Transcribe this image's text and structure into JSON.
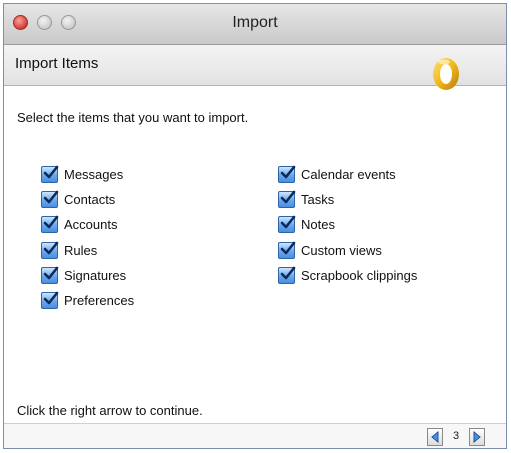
{
  "window": {
    "title": "Import"
  },
  "header": {
    "title": "Import Items",
    "logo_icon": "outlook-o-logo-icon"
  },
  "instruction": "Select the items that you want to import.",
  "items_left": [
    {
      "label": "Messages",
      "checked": true
    },
    {
      "label": "Contacts",
      "checked": true
    },
    {
      "label": "Accounts",
      "checked": true
    },
    {
      "label": "Rules",
      "checked": true
    },
    {
      "label": "Signatures",
      "checked": true
    },
    {
      "label": "Preferences",
      "checked": true
    }
  ],
  "items_right": [
    {
      "label": "Calendar events",
      "checked": true
    },
    {
      "label": "Tasks",
      "checked": true
    },
    {
      "label": "Notes",
      "checked": true
    },
    {
      "label": "Custom views",
      "checked": true
    },
    {
      "label": "Scrapbook clippings",
      "checked": true
    }
  ],
  "footer": {
    "hint": "Click the right arrow to continue.",
    "page": "3"
  },
  "colors": {
    "accent": "#3b82d6",
    "logo": "#e8b41a"
  }
}
